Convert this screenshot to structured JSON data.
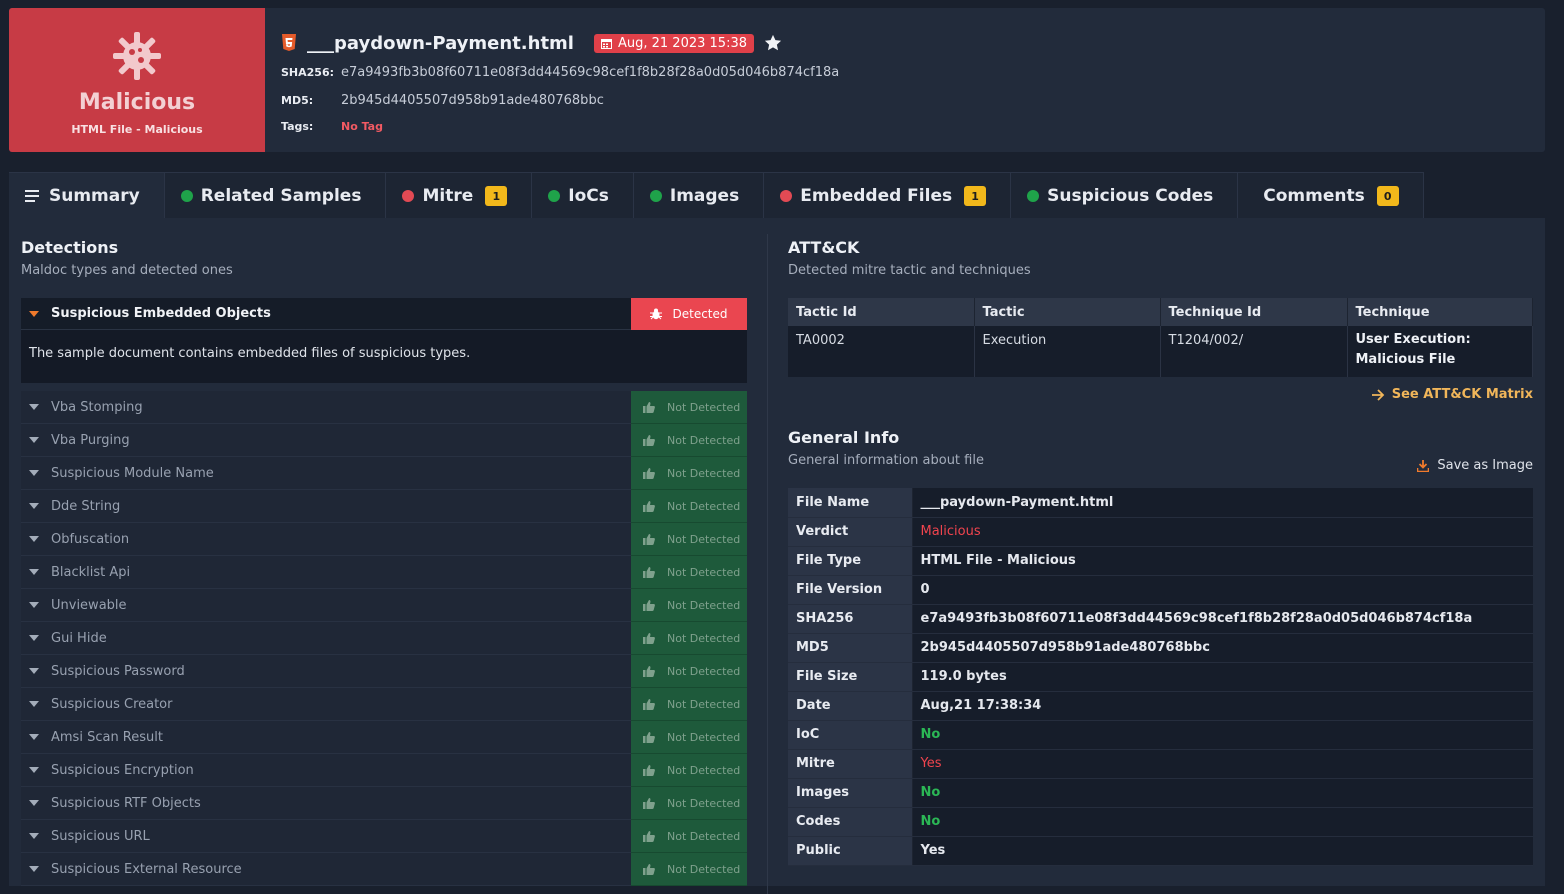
{
  "verdict": {
    "title": "Malicious",
    "subtitle": "HTML File - Malicious",
    "color": "#c73b45"
  },
  "file": {
    "name": "___paydown-Payment.html",
    "date": "Aug, 21 2023 15:38",
    "sha256_label": "SHA256:",
    "sha256": "e7a9493fb3b08f60711e08f3dd44569c98cef1f8b28f28a0d05d046b874cf18a",
    "md5_label": "MD5:",
    "md5": "2b945d4405507d958b91ade480768bbc",
    "tags_label": "Tags:",
    "tags": "No Tag"
  },
  "tabs": [
    {
      "label": "Summary",
      "icon": "menu-icon"
    },
    {
      "label": "Related Samples",
      "status": "green"
    },
    {
      "label": "Mitre",
      "status": "red",
      "count": "1"
    },
    {
      "label": "IoCs",
      "status": "green"
    },
    {
      "label": "Images",
      "status": "green"
    },
    {
      "label": "Embedded Files",
      "status": "red",
      "count": "1"
    },
    {
      "label": "Suspicious Codes",
      "status": "green"
    },
    {
      "label": "Comments",
      "count": "0"
    }
  ],
  "detections": {
    "title": "Detections",
    "subtitle": "Maldoc types and detected ones",
    "open_item": {
      "name": "Suspicious Embedded Objects",
      "status": "Detected",
      "description": "The sample document contains embedded files of suspicious types."
    },
    "not_detected_label": "Not Detected",
    "items": [
      "Vba Stomping",
      "Vba Purging",
      "Suspicious Module Name",
      "Dde String",
      "Obfuscation",
      "Blacklist Api",
      "Unviewable",
      "Gui Hide",
      "Suspicious Password",
      "Suspicious Creator",
      "Amsi Scan Result",
      "Suspicious Encryption",
      "Suspicious RTF Objects",
      "Suspicious URL",
      "Suspicious External Resource"
    ]
  },
  "attack": {
    "title": "ATT&CK",
    "subtitle": "Detected mitre tactic and techniques",
    "headers": [
      "Tactic Id",
      "Tactic",
      "Technique Id",
      "Technique"
    ],
    "row": [
      "TA0002",
      "Execution",
      "T1204/002/",
      "User Execution: Malicious File"
    ],
    "matrix_link": "See ATT&CK Matrix"
  },
  "general": {
    "title": "General Info",
    "subtitle": "General information about file",
    "save_label": "Save as Image",
    "rows": [
      {
        "key": "File Name",
        "value": "___paydown-Payment.html"
      },
      {
        "key": "Verdict",
        "value": "Malicious"
      },
      {
        "key": "File Type",
        "value": "HTML File - Malicious"
      },
      {
        "key": "File Version",
        "value": "0"
      },
      {
        "key": "SHA256",
        "value": "e7a9493fb3b08f60711e08f3dd44569c98cef1f8b28f28a0d05d046b874cf18a"
      },
      {
        "key": "MD5",
        "value": "2b945d4405507d958b91ade480768bbc"
      },
      {
        "key": "File Size",
        "value": "119.0 bytes"
      },
      {
        "key": "Date",
        "value": "Aug,21 17:38:34"
      },
      {
        "key": "IoC",
        "value": "No"
      },
      {
        "key": "Mitre",
        "value": "Yes"
      },
      {
        "key": "Images",
        "value": "No"
      },
      {
        "key": "Codes",
        "value": "No"
      },
      {
        "key": "Public",
        "value": "Yes"
      }
    ]
  }
}
